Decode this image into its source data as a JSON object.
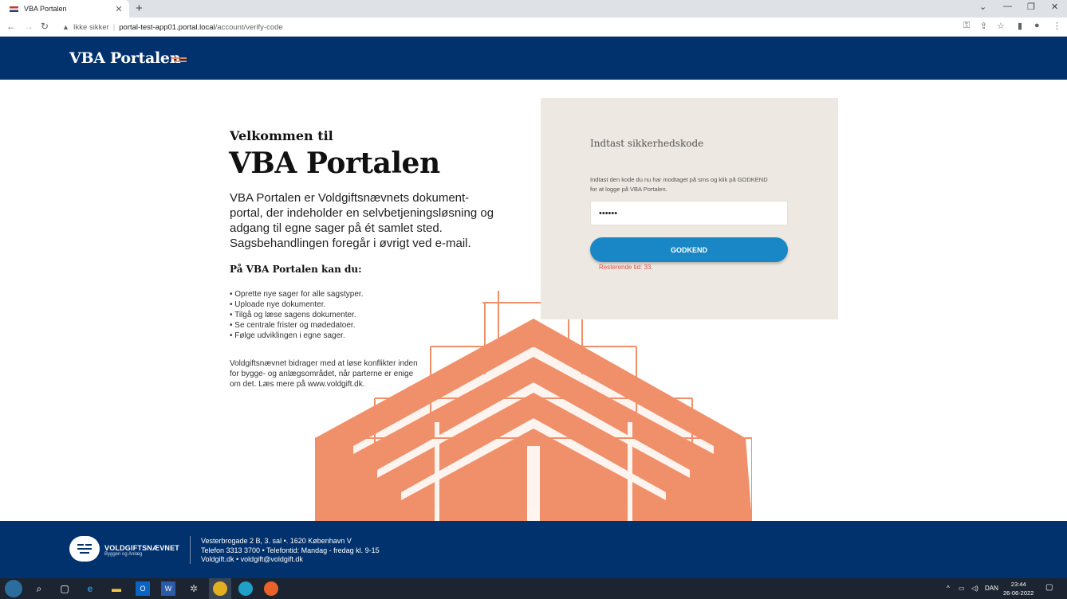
{
  "browser": {
    "tab_title": "VBA Portalen",
    "tab_close": "✕",
    "new_tab": "+",
    "security_label": "Ikke sikker",
    "url_host": "portal-test-app01.portal.local",
    "url_path": "/account/verify-code"
  },
  "header": {
    "logo_text": "VBA Portalen"
  },
  "welcome": {
    "small": "Velkommen til",
    "big": "VBA Portalen",
    "intro": "VBA Portalen er Voldgiftsnævnets dokument-portal, der indeholder en selvbetjeningsløsning og adgang til egne sager på ét samlet sted. Sagsbehandlingen foregår i øvrigt ved e-mail.",
    "can_title": "På VBA Portalen kan du:",
    "bullets": [
      "• Oprette nye sager for alle sagstyper.",
      "• Uploade nye dokumenter.",
      "• Tilgå og læse sagens dokumenter.",
      "• Se centrale frister og mødedatoer.",
      "• Følge udviklingen i egne sager."
    ],
    "note": "Voldgiftsnævnet bidrager med at løse konflikter inden for bygge- og anlægsområdet, når parterne er enige om det. Læs mere på www.voldgift.dk."
  },
  "login": {
    "title": "Indtast sikkerhedskode",
    "description": "Indtast den kode du nu har modtaget på sms og klik på GODKEND for at logge på VBA Portalen.",
    "code_value": "••••••",
    "submit_label": "GODKEND",
    "remaining": "Resterende tid: 33."
  },
  "footer": {
    "brand": "VOLDGIFTSNÆVNET",
    "brand_sub": "Byggeri og Anlæg",
    "line1": "Vesterbrogade 2 B, 3. sal •. 1620 København V",
    "line2": "Telefon 3313 3700 • Telefontid: Mandag - fredag kl. 9-15",
    "line3": "Voldgift.dk • voldgift@voldgift.dk"
  },
  "taskbar": {
    "language": "DAN",
    "time": "23:44",
    "date": "26-06-2022"
  },
  "colors": {
    "brand_navy": "#01326e",
    "accent_orange": "#f08a5d",
    "button_blue": "#1987c5",
    "panel_beige": "#ede8e1",
    "error_red": "#d9534f"
  }
}
